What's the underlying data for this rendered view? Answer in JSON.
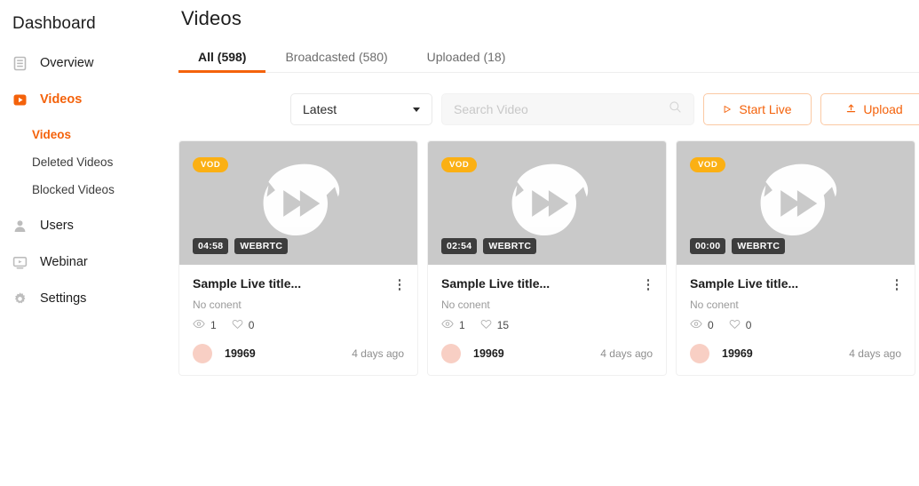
{
  "sidebar": {
    "brand": "Dashboard",
    "items": [
      {
        "label": "Overview",
        "icon": "list-document-icon",
        "active": false
      },
      {
        "label": "Videos",
        "icon": "video-play-icon",
        "active": true
      },
      {
        "label": "Users",
        "icon": "user-icon",
        "active": false
      },
      {
        "label": "Webinar",
        "icon": "monitor-play-icon",
        "active": false
      },
      {
        "label": "Settings",
        "icon": "gear-icon",
        "active": false
      }
    ],
    "sub_items": [
      {
        "label": "Videos",
        "active": true
      },
      {
        "label": "Deleted Videos",
        "active": false
      },
      {
        "label": "Blocked Videos",
        "active": false
      }
    ]
  },
  "header": {
    "title": "Videos"
  },
  "tabs": [
    {
      "label": "All (598)",
      "active": true
    },
    {
      "label": "Broadcasted (580)",
      "active": false
    },
    {
      "label": "Uploaded (18)",
      "active": false
    }
  ],
  "toolbar": {
    "sort_value": "Latest",
    "sort_options": [
      "Latest"
    ],
    "search_placeholder": "Search Video",
    "search_value": "",
    "start_live_label": "Start Live",
    "upload_label": "Upload"
  },
  "colors": {
    "accent": "#f4620b",
    "badge_vod": "#fbb014",
    "meta_pill": "#3d3d3d",
    "thumb_bg": "#c9c9c9",
    "avatar": "#f8cfc4"
  },
  "cards": [
    {
      "badge": "VOD",
      "duration": "04:58",
      "protocol": "WEBRTC",
      "title": "Sample Live title...",
      "subtitle": "No conent",
      "views": "1",
      "likes": "0",
      "user": "19969",
      "ago": "4 days ago"
    },
    {
      "badge": "VOD",
      "duration": "02:54",
      "protocol": "WEBRTC",
      "title": "Sample Live title...",
      "subtitle": "No conent",
      "views": "1",
      "likes": "15",
      "user": "19969",
      "ago": "4 days ago"
    },
    {
      "badge": "VOD",
      "duration": "00:00",
      "protocol": "WEBRTC",
      "title": "Sample Live title...",
      "subtitle": "No conent",
      "views": "0",
      "likes": "0",
      "user": "19969",
      "ago": "4 days ago"
    }
  ]
}
